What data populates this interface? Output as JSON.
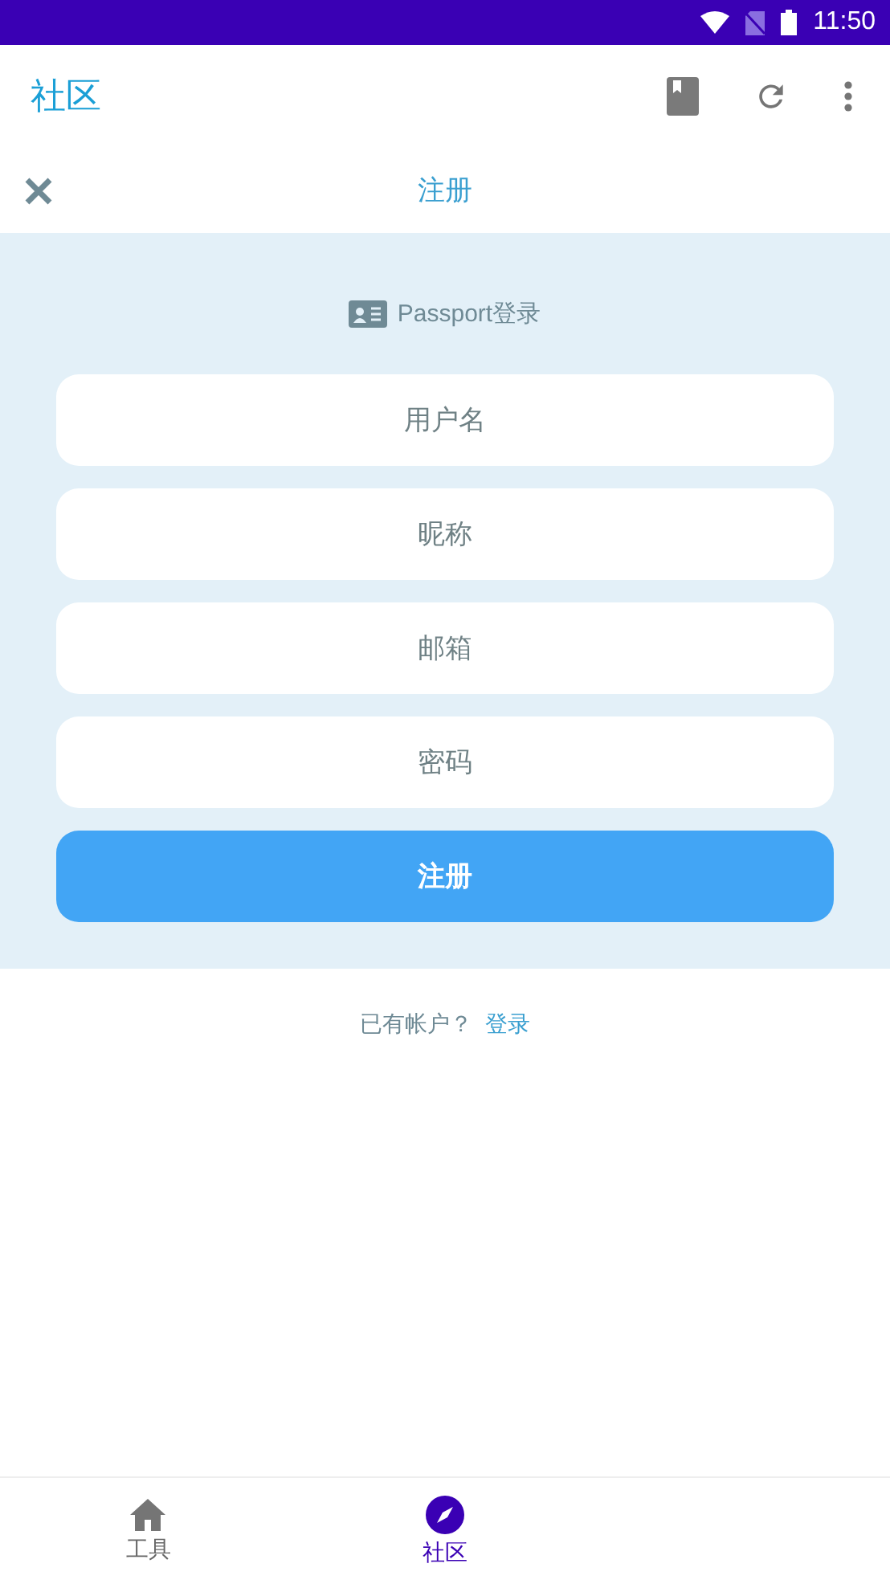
{
  "status_bar": {
    "time": "11:50"
  },
  "app_bar": {
    "title": "社区"
  },
  "dialog": {
    "title": "注册"
  },
  "form": {
    "passport_label": "Passport登录",
    "fields": [
      {
        "placeholder": "用户名"
      },
      {
        "placeholder": "昵称"
      },
      {
        "placeholder": "邮箱"
      },
      {
        "placeholder": "密码"
      }
    ],
    "submit": "注册"
  },
  "account_prompt": {
    "text": "已有帐户？",
    "link": "登录"
  },
  "bottom_nav": [
    {
      "label": "工具",
      "kind": "home",
      "selected": false
    },
    {
      "label": "社区",
      "kind": "compass",
      "selected": true
    }
  ]
}
